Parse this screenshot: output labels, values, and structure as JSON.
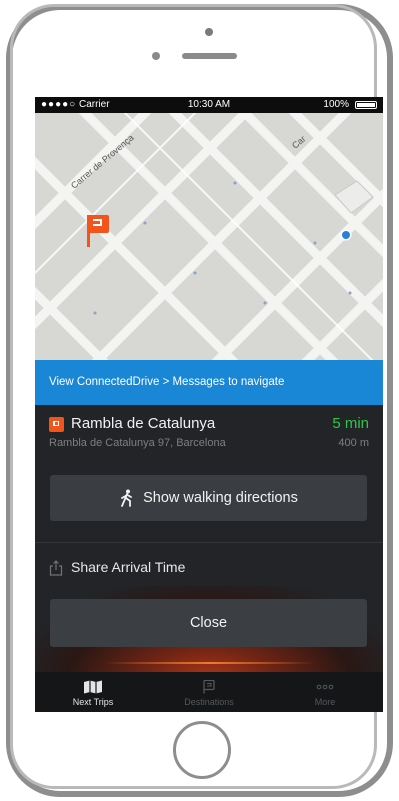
{
  "status_bar": {
    "carrier": "Carrier",
    "time": "10:30 AM",
    "battery": "100%"
  },
  "map": {
    "street_labels": [
      "Carrer de Provença",
      "Car"
    ]
  },
  "banner": {
    "text": "View ConnectedDrive > Messages to navigate"
  },
  "destination": {
    "name": "Rambla de Catalunya",
    "address": "Rambla de Catalunya 97, Barcelona",
    "eta": "5 min",
    "distance": "400 m"
  },
  "actions": {
    "walk_label": "Show walking directions",
    "share_label": "Share Arrival Time",
    "close_label": "Close"
  },
  "tabs": [
    {
      "label": "Next Trips",
      "icon": "next-trips-icon",
      "active": true
    },
    {
      "label": "Destinations",
      "icon": "destinations-icon",
      "active": false
    },
    {
      "label": "More",
      "icon": "more-icon",
      "active": false
    }
  ],
  "colors": {
    "banner": "#1a86d6",
    "eta": "#2fc64a",
    "flag": "#f2541b",
    "panel": "#222427"
  }
}
